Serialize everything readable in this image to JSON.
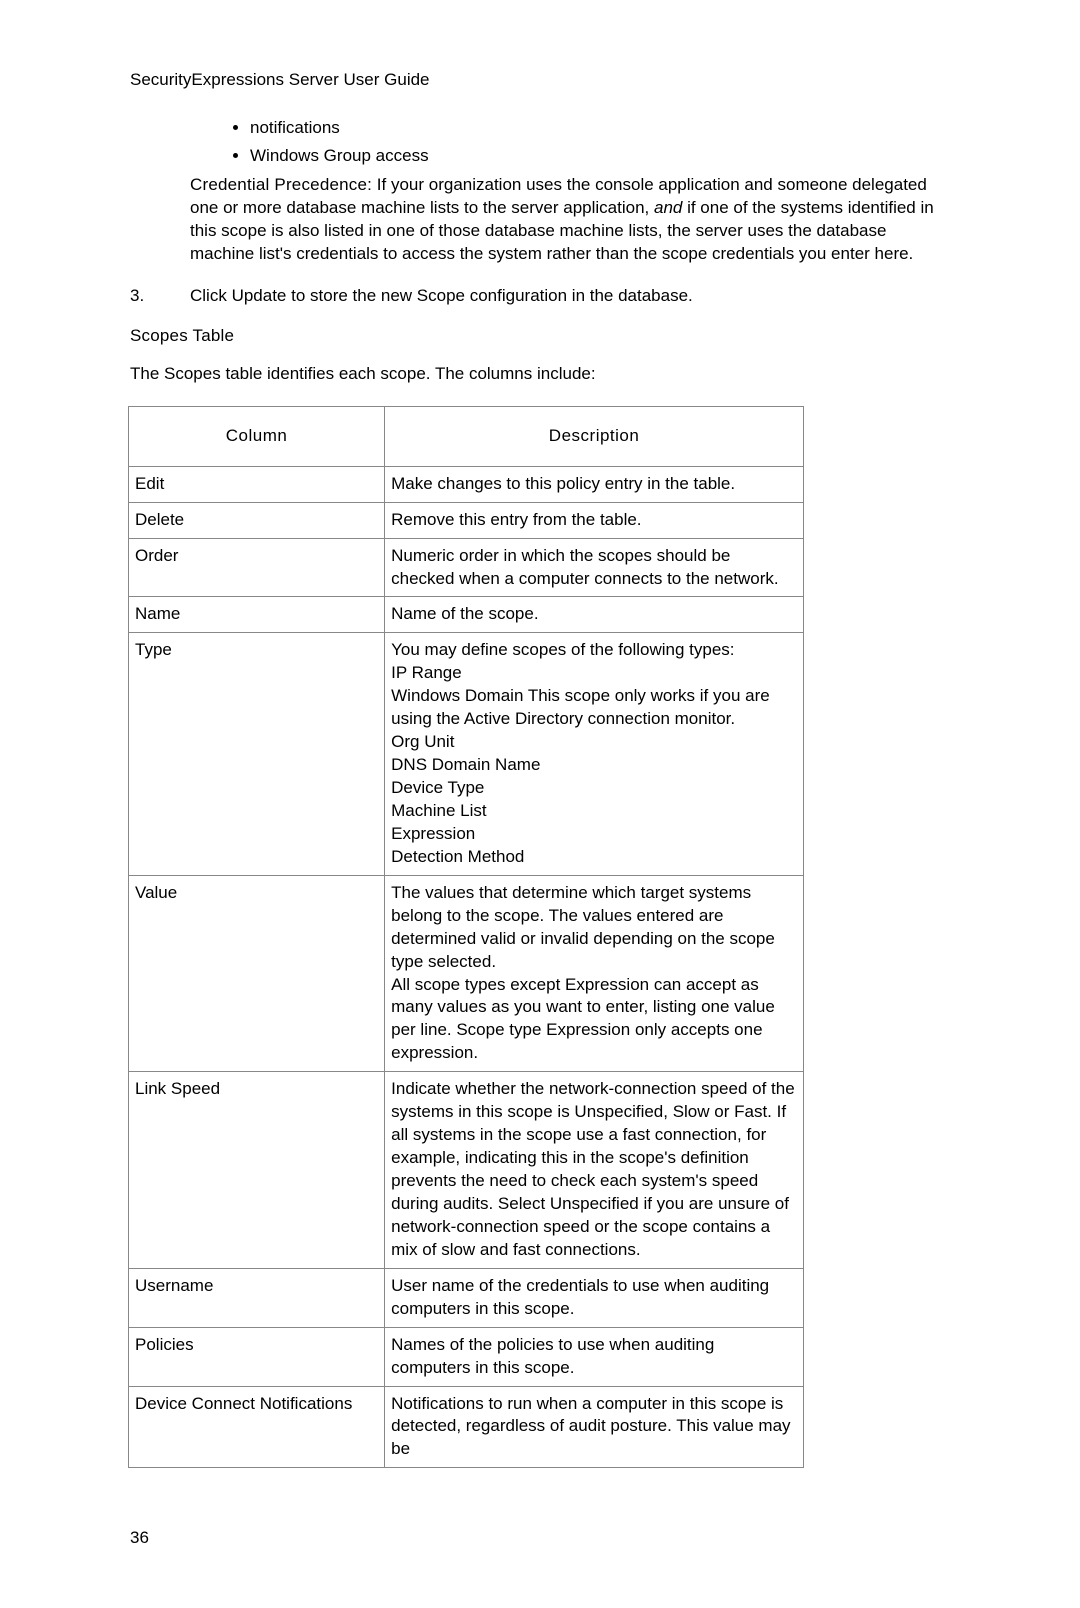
{
  "header": "SecurityExpressions Server User Guide",
  "bullets": [
    "notifications",
    "Windows Group access"
  ],
  "cred": {
    "label": "Credential Precedence:",
    "text_a": " If your organization uses the console application and someone delegated one or more database machine lists to the server application, ",
    "and": "and",
    "text_b": " if one of the systems identified in this scope is also listed in one of those database machine lists, the server uses the database machine list's credentials to access the system rather than the scope credentials you enter here."
  },
  "step": {
    "num": "3.",
    "text_a": "Click ",
    "update": "Update",
    "text_b": " to store the new Scope configuration in the database."
  },
  "section": "Scopes Table",
  "intro": "The Scopes table identifies each scope. The columns include:",
  "table_headers": {
    "col": "Column",
    "desc": "Description"
  },
  "rows": [
    {
      "col": "Edit",
      "desc": "Make changes to this policy entry in the table."
    },
    {
      "col": "Delete",
      "desc": "Remove this entry from the table."
    },
    {
      "col": "Order",
      "desc": "Numeric order in which the scopes should be checked when a computer connects to the network."
    },
    {
      "col": "Name",
      "desc": "Name of the scope."
    },
    {
      "col": "Type",
      "desc": "You may define scopes of the following types:\nIP Range\nWindows Domain This scope only works if you are using the Active Directory connection monitor.\nOrg Unit\nDNS Domain Name\nDevice Type\nMachine List\nExpression\nDetection Method"
    },
    {
      "col": "Value",
      "desc": "The values that determine which target systems belong to the scope. The values entered are determined valid or invalid depending on the scope type selected.\nAll scope types except Expression can accept as many values as you want to enter, listing one value per line. Scope type Expression only accepts one expression."
    },
    {
      "col": "Link Speed",
      "desc": "Indicate whether the network-connection speed of the systems in this scope is Unspecified, Slow or Fast. If all systems in the scope use a fast connection, for example, indicating this in the scope's definition prevents the need to check each system's speed during audits. Select Unspecified if you are unsure of network-connection speed or the scope contains a mix of slow and fast connections."
    },
    {
      "col": "Username",
      "desc": "User name of the credentials to use when auditing computers in this scope."
    },
    {
      "col": "Policies",
      "desc": "Names of the policies to use when auditing computers in this scope."
    },
    {
      "col": "Device Connect Notifications",
      "desc": "Notifications to run when a computer in this scope is detected, regardless of audit posture. This value may be"
    }
  ],
  "page_num": "36"
}
